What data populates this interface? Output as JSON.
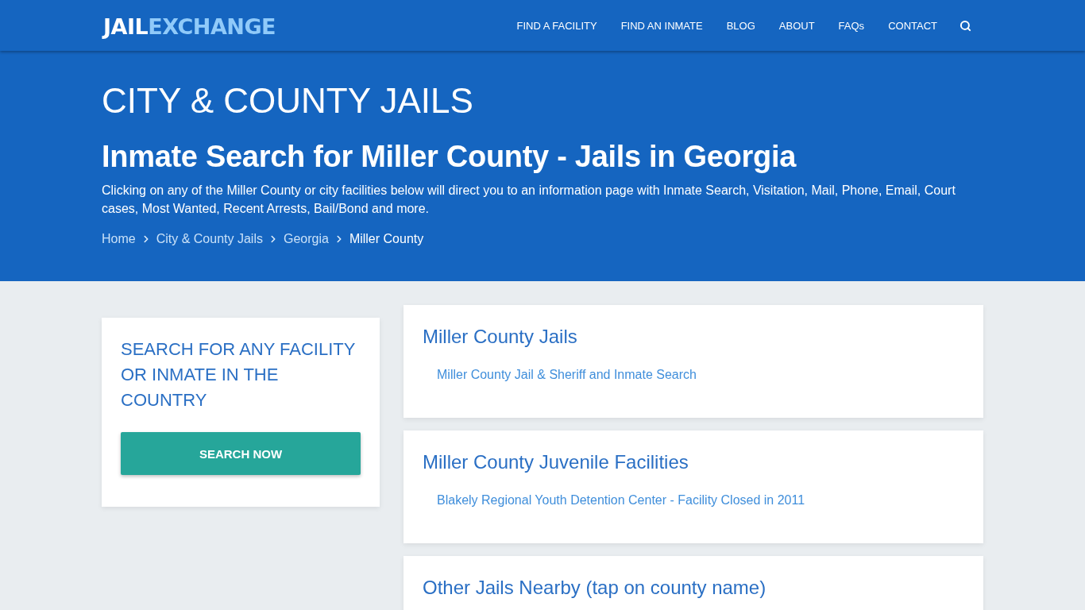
{
  "header": {
    "logo": {
      "part_1": "JAIL",
      "part_2": "EXCHANGE"
    },
    "nav": [
      {
        "label": "FIND A FACILITY"
      },
      {
        "label": "FIND AN INMATE"
      },
      {
        "label": "BLOG"
      },
      {
        "label": "ABOUT"
      },
      {
        "label": "FAQs"
      },
      {
        "label": "CONTACT"
      }
    ]
  },
  "hero": {
    "category": "CITY & COUNTY JAILS",
    "title": "Inmate Search for Miller County - Jails in Georgia",
    "description": "Clicking on any of the Miller County or city facilities below will direct you to an information page with Inmate Search, Visitation, Mail, Phone, Email, Court cases, Most Wanted, Recent Arrests, Bail/Bond and more.",
    "breadcrumb": [
      {
        "label": "Home",
        "selected": false
      },
      {
        "label": "City & County Jails",
        "selected": false
      },
      {
        "label": "Georgia",
        "selected": false
      },
      {
        "label": "Miller County",
        "selected": true
      }
    ]
  },
  "search_card": {
    "heading": "SEARCH FOR ANY FACILITY OR INMATE IN THE COUNTRY",
    "button": "SEARCH NOW"
  },
  "sections": [
    {
      "heading": "Miller County Jails",
      "links": [
        "Miller County Jail & Sheriff and Inmate Search"
      ]
    },
    {
      "heading": "Miller County Juvenile Facilities",
      "links": [
        "Blakely Regional Youth Detention Center - Facility Closed in 2011"
      ]
    },
    {
      "heading": "Other Jails Nearby (tap on county name)"
    }
  ]
}
